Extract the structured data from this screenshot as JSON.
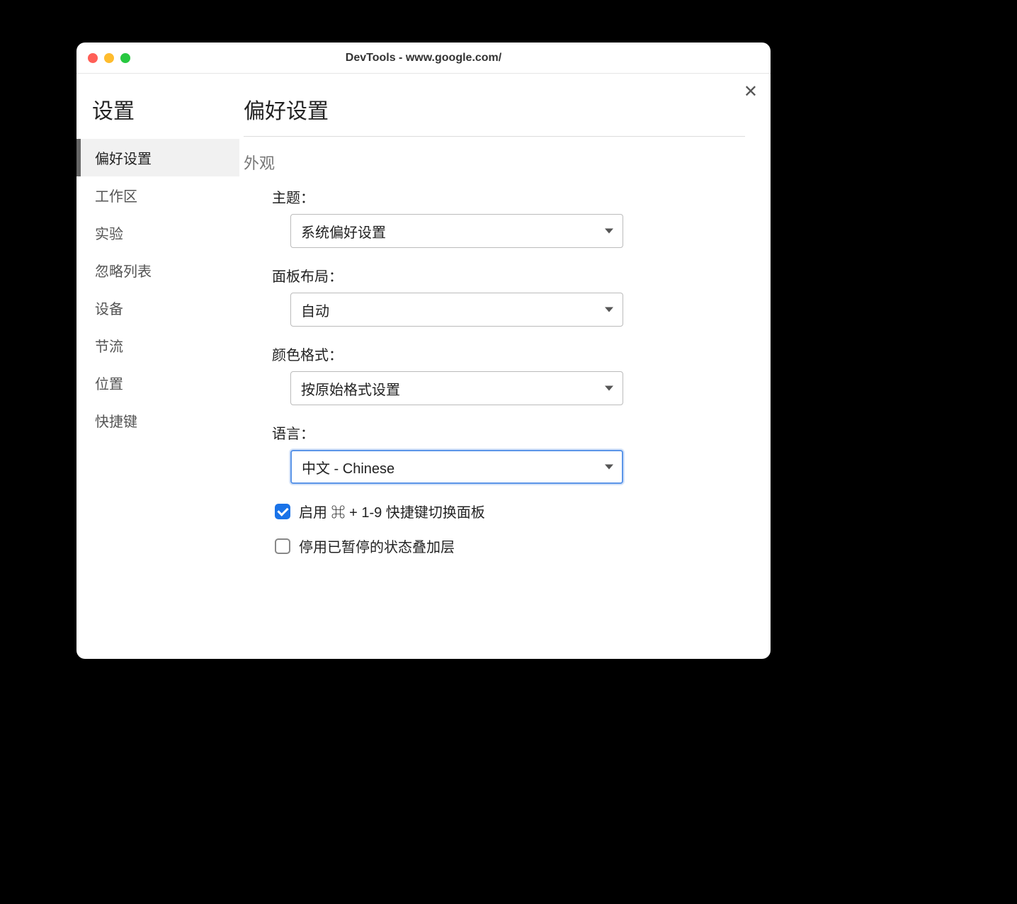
{
  "window": {
    "title": "DevTools - www.google.com/"
  },
  "sidebar": {
    "title": "设置",
    "items": [
      {
        "label": "偏好设置",
        "active": true
      },
      {
        "label": "工作区",
        "active": false
      },
      {
        "label": "实验",
        "active": false
      },
      {
        "label": "忽略列表",
        "active": false
      },
      {
        "label": "设备",
        "active": false
      },
      {
        "label": "节流",
        "active": false
      },
      {
        "label": "位置",
        "active": false
      },
      {
        "label": "快捷键",
        "active": false
      }
    ]
  },
  "main": {
    "title": "偏好设置",
    "section_appearance": "外观",
    "theme": {
      "label": "主题：",
      "value": "系统偏好设置"
    },
    "panel_layout": {
      "label": "面板布局：",
      "value": "自动"
    },
    "color_format": {
      "label": "颜色格式：",
      "value": "按原始格式设置"
    },
    "language": {
      "label": "语言：",
      "value": "中文 - Chinese"
    },
    "cb_shortcut": {
      "label": "启用 ⌘ + 1-9 快捷键切换面板",
      "checked": true
    },
    "cb_overlay": {
      "label": "停用已暂停的状态叠加层",
      "checked": false
    }
  }
}
